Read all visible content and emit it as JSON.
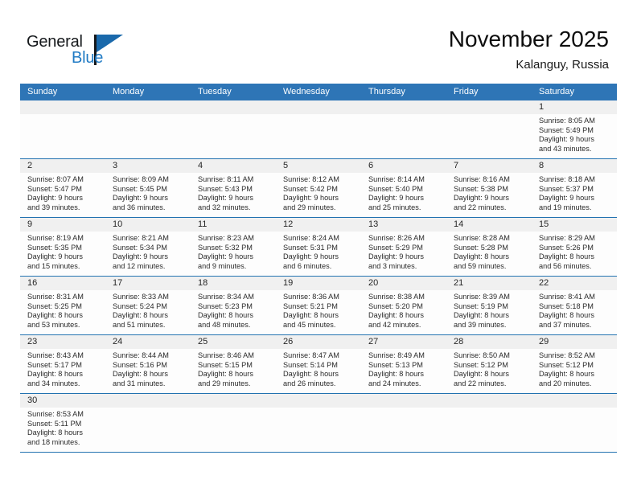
{
  "brand": {
    "name_part1": "General",
    "name_part2": "Blue",
    "accent_color": "#1f7ac4",
    "flag_color": "#1a69ab"
  },
  "header": {
    "title": "November 2025",
    "subtitle": "Kalanguy, Russia",
    "header_bg": "#2e75b6",
    "daynum_bg": "#f0f0f0",
    "separator_color": "#2272b0"
  },
  "weekdays": [
    "Sunday",
    "Monday",
    "Tuesday",
    "Wednesday",
    "Thursday",
    "Friday",
    "Saturday"
  ],
  "weeks": [
    [
      {
        "day": "",
        "empty": true
      },
      {
        "day": "",
        "empty": true
      },
      {
        "day": "",
        "empty": true
      },
      {
        "day": "",
        "empty": true
      },
      {
        "day": "",
        "empty": true
      },
      {
        "day": "",
        "empty": true
      },
      {
        "day": "1",
        "sunrise": "Sunrise: 8:05 AM",
        "sunset": "Sunset: 5:49 PM",
        "daylight1": "Daylight: 9 hours",
        "daylight2": "and 43 minutes."
      }
    ],
    [
      {
        "day": "2",
        "sunrise": "Sunrise: 8:07 AM",
        "sunset": "Sunset: 5:47 PM",
        "daylight1": "Daylight: 9 hours",
        "daylight2": "and 39 minutes."
      },
      {
        "day": "3",
        "sunrise": "Sunrise: 8:09 AM",
        "sunset": "Sunset: 5:45 PM",
        "daylight1": "Daylight: 9 hours",
        "daylight2": "and 36 minutes."
      },
      {
        "day": "4",
        "sunrise": "Sunrise: 8:11 AM",
        "sunset": "Sunset: 5:43 PM",
        "daylight1": "Daylight: 9 hours",
        "daylight2": "and 32 minutes."
      },
      {
        "day": "5",
        "sunrise": "Sunrise: 8:12 AM",
        "sunset": "Sunset: 5:42 PM",
        "daylight1": "Daylight: 9 hours",
        "daylight2": "and 29 minutes."
      },
      {
        "day": "6",
        "sunrise": "Sunrise: 8:14 AM",
        "sunset": "Sunset: 5:40 PM",
        "daylight1": "Daylight: 9 hours",
        "daylight2": "and 25 minutes."
      },
      {
        "day": "7",
        "sunrise": "Sunrise: 8:16 AM",
        "sunset": "Sunset: 5:38 PM",
        "daylight1": "Daylight: 9 hours",
        "daylight2": "and 22 minutes."
      },
      {
        "day": "8",
        "sunrise": "Sunrise: 8:18 AM",
        "sunset": "Sunset: 5:37 PM",
        "daylight1": "Daylight: 9 hours",
        "daylight2": "and 19 minutes."
      }
    ],
    [
      {
        "day": "9",
        "sunrise": "Sunrise: 8:19 AM",
        "sunset": "Sunset: 5:35 PM",
        "daylight1": "Daylight: 9 hours",
        "daylight2": "and 15 minutes."
      },
      {
        "day": "10",
        "sunrise": "Sunrise: 8:21 AM",
        "sunset": "Sunset: 5:34 PM",
        "daylight1": "Daylight: 9 hours",
        "daylight2": "and 12 minutes."
      },
      {
        "day": "11",
        "sunrise": "Sunrise: 8:23 AM",
        "sunset": "Sunset: 5:32 PM",
        "daylight1": "Daylight: 9 hours",
        "daylight2": "and 9 minutes."
      },
      {
        "day": "12",
        "sunrise": "Sunrise: 8:24 AM",
        "sunset": "Sunset: 5:31 PM",
        "daylight1": "Daylight: 9 hours",
        "daylight2": "and 6 minutes."
      },
      {
        "day": "13",
        "sunrise": "Sunrise: 8:26 AM",
        "sunset": "Sunset: 5:29 PM",
        "daylight1": "Daylight: 9 hours",
        "daylight2": "and 3 minutes."
      },
      {
        "day": "14",
        "sunrise": "Sunrise: 8:28 AM",
        "sunset": "Sunset: 5:28 PM",
        "daylight1": "Daylight: 8 hours",
        "daylight2": "and 59 minutes."
      },
      {
        "day": "15",
        "sunrise": "Sunrise: 8:29 AM",
        "sunset": "Sunset: 5:26 PM",
        "daylight1": "Daylight: 8 hours",
        "daylight2": "and 56 minutes."
      }
    ],
    [
      {
        "day": "16",
        "sunrise": "Sunrise: 8:31 AM",
        "sunset": "Sunset: 5:25 PM",
        "daylight1": "Daylight: 8 hours",
        "daylight2": "and 53 minutes."
      },
      {
        "day": "17",
        "sunrise": "Sunrise: 8:33 AM",
        "sunset": "Sunset: 5:24 PM",
        "daylight1": "Daylight: 8 hours",
        "daylight2": "and 51 minutes."
      },
      {
        "day": "18",
        "sunrise": "Sunrise: 8:34 AM",
        "sunset": "Sunset: 5:23 PM",
        "daylight1": "Daylight: 8 hours",
        "daylight2": "and 48 minutes."
      },
      {
        "day": "19",
        "sunrise": "Sunrise: 8:36 AM",
        "sunset": "Sunset: 5:21 PM",
        "daylight1": "Daylight: 8 hours",
        "daylight2": "and 45 minutes."
      },
      {
        "day": "20",
        "sunrise": "Sunrise: 8:38 AM",
        "sunset": "Sunset: 5:20 PM",
        "daylight1": "Daylight: 8 hours",
        "daylight2": "and 42 minutes."
      },
      {
        "day": "21",
        "sunrise": "Sunrise: 8:39 AM",
        "sunset": "Sunset: 5:19 PM",
        "daylight1": "Daylight: 8 hours",
        "daylight2": "and 39 minutes."
      },
      {
        "day": "22",
        "sunrise": "Sunrise: 8:41 AM",
        "sunset": "Sunset: 5:18 PM",
        "daylight1": "Daylight: 8 hours",
        "daylight2": "and 37 minutes."
      }
    ],
    [
      {
        "day": "23",
        "sunrise": "Sunrise: 8:43 AM",
        "sunset": "Sunset: 5:17 PM",
        "daylight1": "Daylight: 8 hours",
        "daylight2": "and 34 minutes."
      },
      {
        "day": "24",
        "sunrise": "Sunrise: 8:44 AM",
        "sunset": "Sunset: 5:16 PM",
        "daylight1": "Daylight: 8 hours",
        "daylight2": "and 31 minutes."
      },
      {
        "day": "25",
        "sunrise": "Sunrise: 8:46 AM",
        "sunset": "Sunset: 5:15 PM",
        "daylight1": "Daylight: 8 hours",
        "daylight2": "and 29 minutes."
      },
      {
        "day": "26",
        "sunrise": "Sunrise: 8:47 AM",
        "sunset": "Sunset: 5:14 PM",
        "daylight1": "Daylight: 8 hours",
        "daylight2": "and 26 minutes."
      },
      {
        "day": "27",
        "sunrise": "Sunrise: 8:49 AM",
        "sunset": "Sunset: 5:13 PM",
        "daylight1": "Daylight: 8 hours",
        "daylight2": "and 24 minutes."
      },
      {
        "day": "28",
        "sunrise": "Sunrise: 8:50 AM",
        "sunset": "Sunset: 5:12 PM",
        "daylight1": "Daylight: 8 hours",
        "daylight2": "and 22 minutes."
      },
      {
        "day": "29",
        "sunrise": "Sunrise: 8:52 AM",
        "sunset": "Sunset: 5:12 PM",
        "daylight1": "Daylight: 8 hours",
        "daylight2": "and 20 minutes."
      }
    ],
    [
      {
        "day": "30",
        "sunrise": "Sunrise: 8:53 AM",
        "sunset": "Sunset: 5:11 PM",
        "daylight1": "Daylight: 8 hours",
        "daylight2": "and 18 minutes."
      },
      {
        "day": "",
        "empty": true
      },
      {
        "day": "",
        "empty": true
      },
      {
        "day": "",
        "empty": true
      },
      {
        "day": "",
        "empty": true
      },
      {
        "day": "",
        "empty": true
      },
      {
        "day": "",
        "empty": true
      }
    ]
  ]
}
